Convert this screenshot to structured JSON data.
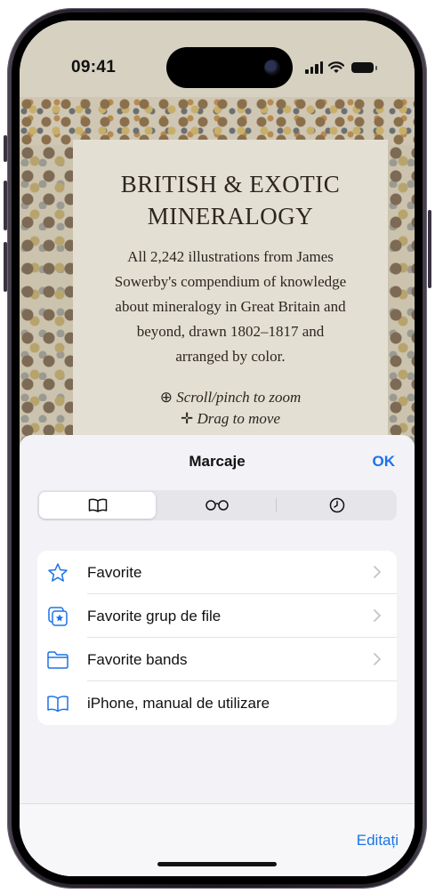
{
  "status_bar": {
    "time": "09:41"
  },
  "webpage": {
    "title": "BRITISH & EXOTIC\nMINERALOGY",
    "description": "All 2,242 illustrations from James\nSowerby's compendium of knowledge\nabout mineralogy in Great Britain and\nbeyond, drawn 1802–1817 and\narranged by color.",
    "hint_zoom": "Scroll/pinch to zoom",
    "hint_move": "Drag to move"
  },
  "sheet": {
    "title": "Marcaje",
    "done_label": "OK",
    "tabs": [
      {
        "icon": "book-icon",
        "active": true
      },
      {
        "icon": "glasses-icon",
        "active": false
      },
      {
        "icon": "clock-icon",
        "active": false
      }
    ],
    "items": [
      {
        "label": "Favorite",
        "icon": "star-icon",
        "has_chevron": true
      },
      {
        "label": "Favorite grup de file",
        "icon": "tab-group-star-icon",
        "has_chevron": true
      },
      {
        "label": "Favorite bands",
        "icon": "folder-icon",
        "has_chevron": true
      },
      {
        "label": "iPhone, manual de utilizare",
        "icon": "book-icon",
        "has_chevron": false
      }
    ],
    "edit_label": "Editați"
  },
  "colors": {
    "accent": "#1a73e8",
    "sheet_bg": "#f2f2f7",
    "card_bg": "#e4dfd3"
  }
}
